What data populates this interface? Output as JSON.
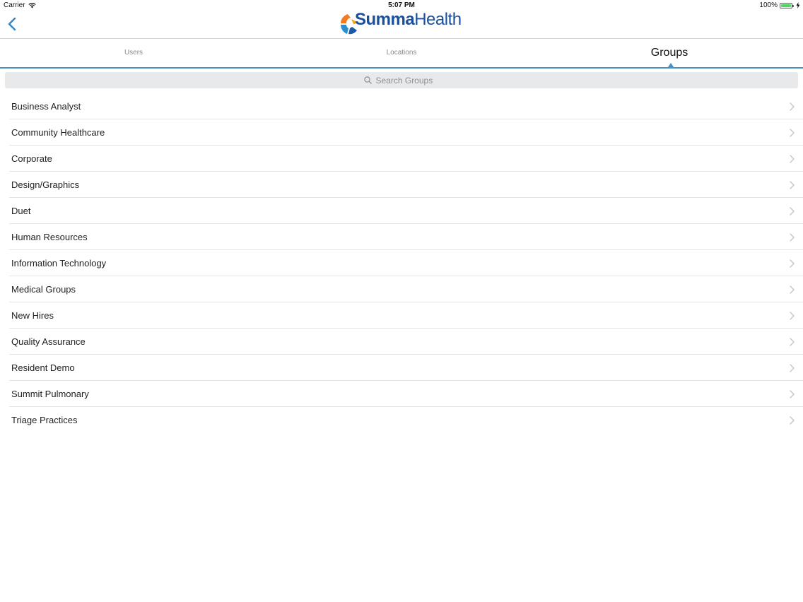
{
  "status_bar": {
    "carrier": "Carrier",
    "time": "5:07 PM",
    "battery": "100%",
    "battery_level": 1.0
  },
  "nav": {
    "logo_text_bold": "Summa",
    "logo_text_regular": "Health",
    "logo_mark": "Summa Health"
  },
  "tabs": [
    {
      "label": "Users",
      "active": false
    },
    {
      "label": "Locations",
      "active": false
    },
    {
      "label": "Groups",
      "active": true
    }
  ],
  "search": {
    "placeholder": "Search Groups",
    "value": ""
  },
  "groups": [
    {
      "label": "Business Analyst"
    },
    {
      "label": "Community Healthcare"
    },
    {
      "label": "Corporate"
    },
    {
      "label": "Design/Graphics"
    },
    {
      "label": "Duet"
    },
    {
      "label": "Human Resources"
    },
    {
      "label": "Information Technology"
    },
    {
      "label": "Medical Groups"
    },
    {
      "label": "New Hires"
    },
    {
      "label": "Quality Assurance"
    },
    {
      "label": "Resident Demo"
    },
    {
      "label": "Summit Pulmonary"
    },
    {
      "label": "Triage Practices"
    }
  ],
  "colors": {
    "accent": "#4a8fc2",
    "brand": "#1a4f9c",
    "logo_orange": "#f47b20",
    "logo_blue": "#2a8fd0"
  },
  "icons": {
    "back": "chevron-left-icon",
    "search": "search-icon",
    "row": "chevron-right-icon",
    "wifi": "wifi-icon",
    "battery": "battery-icon",
    "charging": "bolt-icon"
  }
}
